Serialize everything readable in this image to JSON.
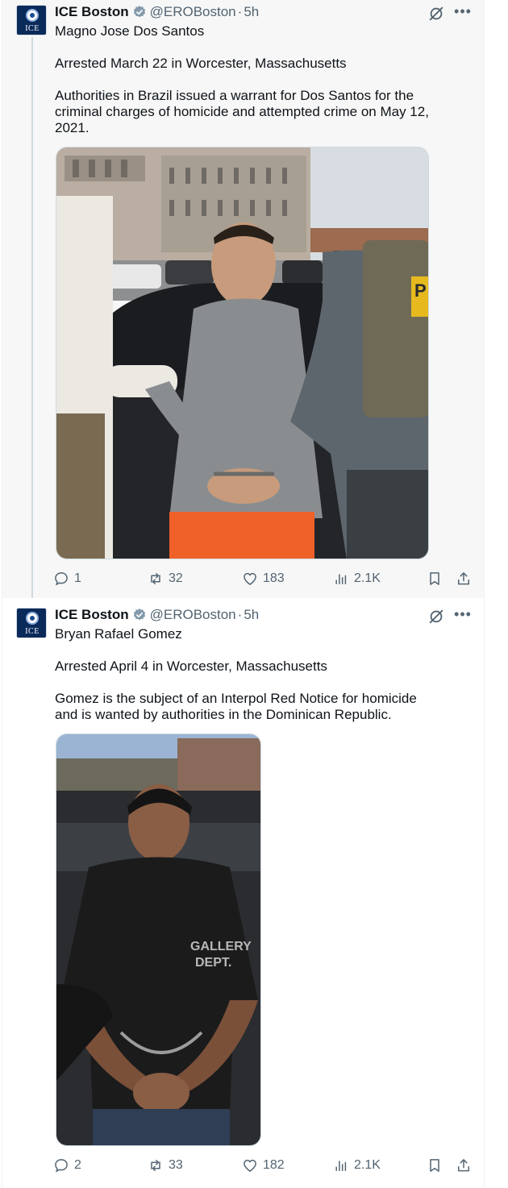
{
  "tweets": [
    {
      "author": {
        "display_name": "ICE Boston",
        "handle": "@EROBoston",
        "avatar_text": "ICE"
      },
      "time": "5h",
      "separator": "·",
      "lines": {
        "name": "Magno Jose Dos Santos",
        "arrest": "Arrested March 22 in Worcester, Massachusetts",
        "detail_1": "Authorities in Brazil issued a warrant for Dos Santos for the",
        "detail_2": "criminal charges of homicide and attempted crime on May 12,",
        "detail_3": "2021."
      },
      "media": {
        "description": "Photo of Magno Jose Dos Santos in handcuffs escorted by officers",
        "vest_text": "P"
      },
      "stats": {
        "replies": "1",
        "reposts": "32",
        "likes": "183",
        "views": "2.1K"
      }
    },
    {
      "author": {
        "display_name": "ICE Boston",
        "handle": "@EROBoston",
        "avatar_text": "ICE"
      },
      "time": "5h",
      "separator": "·",
      "lines": {
        "name": "Bryan Rafael Gomez",
        "arrest": "Arrested April 4 in Worcester, Massachusetts",
        "detail_1": "Gomez is the subject of an Interpol Red Notice for homicide",
        "detail_2": "and is wanted by authorities in the Dominican Republic."
      },
      "media": {
        "description": "Photo of Bryan Rafael Gomez in handcuffs",
        "shirt_text_1": "GALLERY",
        "shirt_text_2": "DEPT."
      },
      "stats": {
        "replies": "2",
        "reposts": "33",
        "likes": "182",
        "views": "2.1K"
      }
    }
  ],
  "colors": {
    "secondary_text": "#536471",
    "verified_badge": "#829aab",
    "divider": "#eff3f4"
  }
}
